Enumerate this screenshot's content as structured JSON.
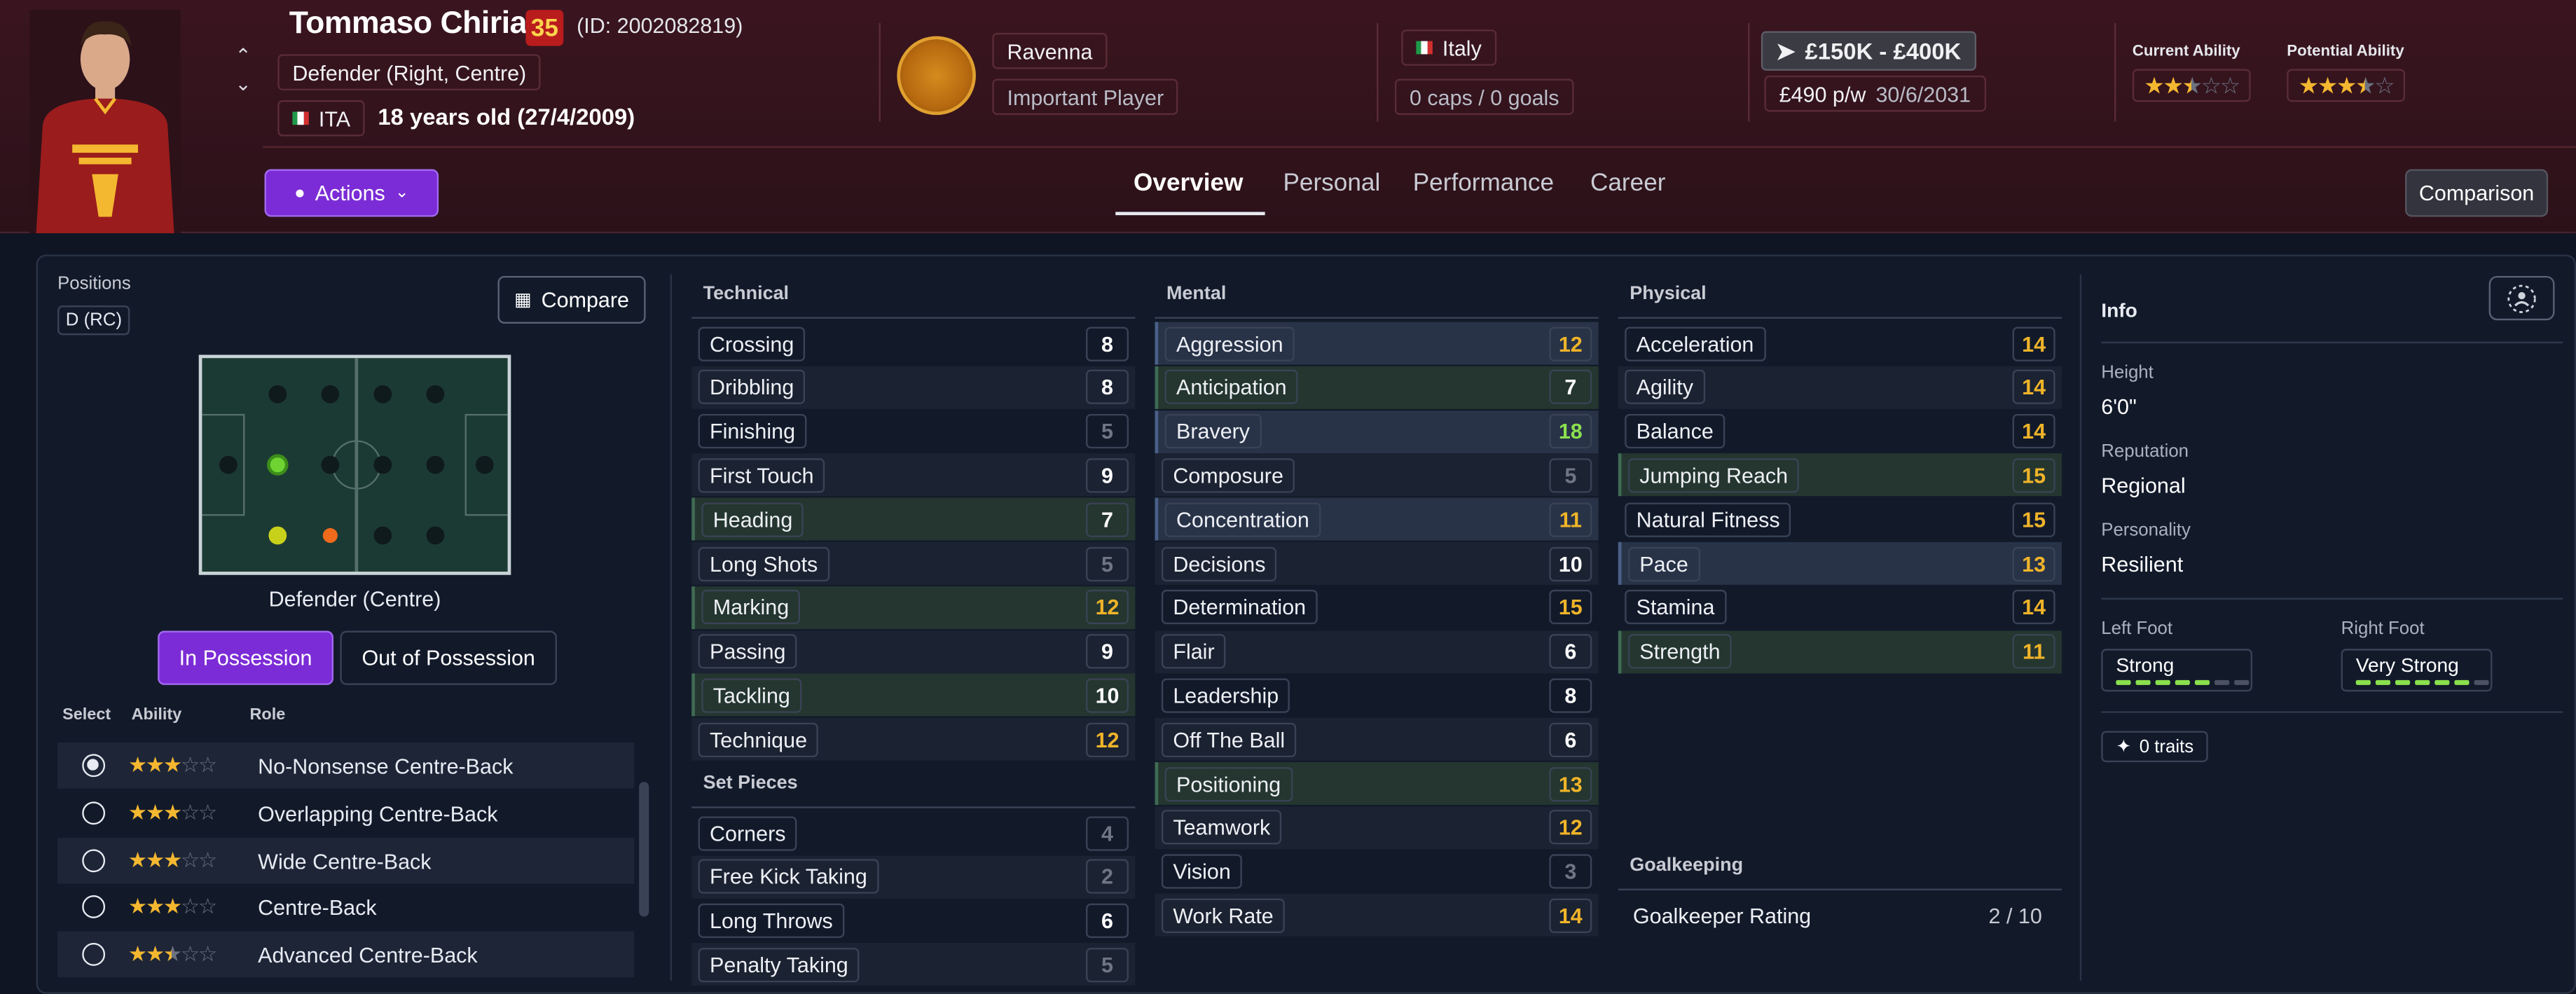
{
  "player": {
    "name": "Tommaso Chiriatti",
    "ca_badge": "35",
    "id_text": "(ID: 2002082819)",
    "position": "Defender (Right, Centre)",
    "nationality_code": "ITA",
    "age_text": "18 years old (27/4/2009)"
  },
  "club": {
    "name": "Ravenna",
    "status": "Important Player"
  },
  "nation": {
    "name": "Italy",
    "caps": "0 caps / 0 goals"
  },
  "contract": {
    "value": "£150K - £400K",
    "wage": "£490 p/w",
    "expiry": "30/6/2031"
  },
  "ability": {
    "current_label": "Current Ability",
    "current_stars": 2.5,
    "potential_label": "Potential Ability",
    "potential_stars": 3.5
  },
  "actions_label": "Actions",
  "tabs": [
    "Overview",
    "Personal",
    "Performance",
    "Career"
  ],
  "active_tab": "Overview",
  "comparison_label": "Comparison",
  "positions": {
    "label": "Positions",
    "tag": "D (RC)",
    "compare_label": "Compare",
    "caption": "Defender (Centre)",
    "in_possession": "In Possession",
    "out_of_possession": "Out of Possession",
    "headers": {
      "select": "Select",
      "ability": "Ability",
      "role": "Role"
    },
    "roles": [
      {
        "name": "No-Nonsense Centre-Back",
        "stars": 3,
        "selected": true
      },
      {
        "name": "Overlapping Centre-Back",
        "stars": 3,
        "selected": false
      },
      {
        "name": "Wide Centre-Back",
        "stars": 3,
        "selected": false
      },
      {
        "name": "Centre-Back",
        "stars": 3,
        "selected": false
      },
      {
        "name": "Advanced Centre-Back",
        "stars": 2.5,
        "selected": false
      }
    ]
  },
  "technical": {
    "title": "Technical",
    "attrs": [
      {
        "name": "Crossing",
        "value": 8
      },
      {
        "name": "Dribbling",
        "value": 8
      },
      {
        "name": "Finishing",
        "value": 5
      },
      {
        "name": "First Touch",
        "value": 9
      },
      {
        "name": "Heading",
        "value": 7
      },
      {
        "name": "Long Shots",
        "value": 5
      },
      {
        "name": "Marking",
        "value": 12
      },
      {
        "name": "Passing",
        "value": 9
      },
      {
        "name": "Tackling",
        "value": 10
      },
      {
        "name": "Technique",
        "value": 12
      }
    ]
  },
  "set_pieces": {
    "title": "Set Pieces",
    "attrs": [
      {
        "name": "Corners",
        "value": 4
      },
      {
        "name": "Free Kick Taking",
        "value": 2
      },
      {
        "name": "Long Throws",
        "value": 6
      },
      {
        "name": "Penalty Taking",
        "value": 5
      }
    ]
  },
  "mental": {
    "title": "Mental",
    "attrs": [
      {
        "name": "Aggression",
        "value": 12
      },
      {
        "name": "Anticipation",
        "value": 7
      },
      {
        "name": "Bravery",
        "value": 18
      },
      {
        "name": "Composure",
        "value": 5
      },
      {
        "name": "Concentration",
        "value": 11
      },
      {
        "name": "Decisions",
        "value": 10
      },
      {
        "name": "Determination",
        "value": 15
      },
      {
        "name": "Flair",
        "value": 6
      },
      {
        "name": "Leadership",
        "value": 8
      },
      {
        "name": "Off The Ball",
        "value": 6
      },
      {
        "name": "Positioning",
        "value": 13
      },
      {
        "name": "Teamwork",
        "value": 12
      },
      {
        "name": "Vision",
        "value": 3
      },
      {
        "name": "Work Rate",
        "value": 14
      }
    ]
  },
  "physical": {
    "title": "Physical",
    "attrs": [
      {
        "name": "Acceleration",
        "value": 14
      },
      {
        "name": "Agility",
        "value": 14
      },
      {
        "name": "Balance",
        "value": 14
      },
      {
        "name": "Jumping Reach",
        "value": 15
      },
      {
        "name": "Natural Fitness",
        "value": 15
      },
      {
        "name": "Pace",
        "value": 13
      },
      {
        "name": "Stamina",
        "value": 14
      },
      {
        "name": "Strength",
        "value": 11
      }
    ]
  },
  "goalkeeping": {
    "title": "Goalkeeping",
    "label": "Goalkeeper Rating",
    "value": "2 / 10"
  },
  "info": {
    "title": "Info",
    "height_label": "Height",
    "height": "6'0\"",
    "reputation_label": "Reputation",
    "reputation": "Regional",
    "personality_label": "Personality",
    "personality": "Resilient",
    "left_foot_label": "Left Foot",
    "left_foot": "Strong",
    "left_foot_level": 5,
    "right_foot_label": "Right Foot",
    "right_foot": "Very Strong",
    "right_foot_level": 6,
    "traits": "0 traits"
  },
  "colors": {
    "accent": "#7c2cd6",
    "gold": "#f0b429",
    "green": "#8be04e",
    "header_bg": "#2c1119"
  }
}
